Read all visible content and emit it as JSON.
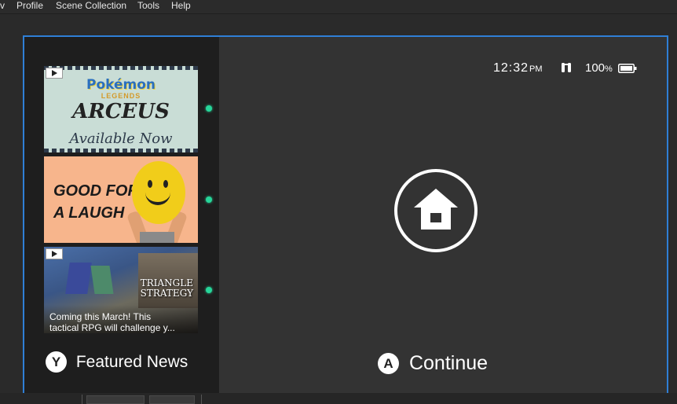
{
  "menubar": {
    "items": [
      "v",
      "Profile",
      "Scene Collection",
      "Tools",
      "Help"
    ]
  },
  "status": {
    "time": "12:32",
    "ampm": "PM",
    "battery": "100",
    "battery_unit": "%"
  },
  "news": [
    {
      "title_line1": "Pokémon",
      "title_line2": "LEGENDS",
      "title_line3": "ARCEUS",
      "subtitle": "Available Now"
    },
    {
      "title_line1": "GOOD FOR",
      "title_line2": "A LAUGH"
    },
    {
      "title_line1": "TRIANGLE",
      "title_line2": "STRATEGY",
      "caption_line1": "Coming this March! This",
      "caption_line2": "tactical RPG will challenge y..."
    }
  ],
  "featured_news": {
    "button": "Y",
    "label": "Featured News"
  },
  "continue": {
    "button": "A",
    "label": "Continue"
  },
  "colors": {
    "accent_border": "#2f7fd6",
    "indicator": "#27d69a"
  }
}
